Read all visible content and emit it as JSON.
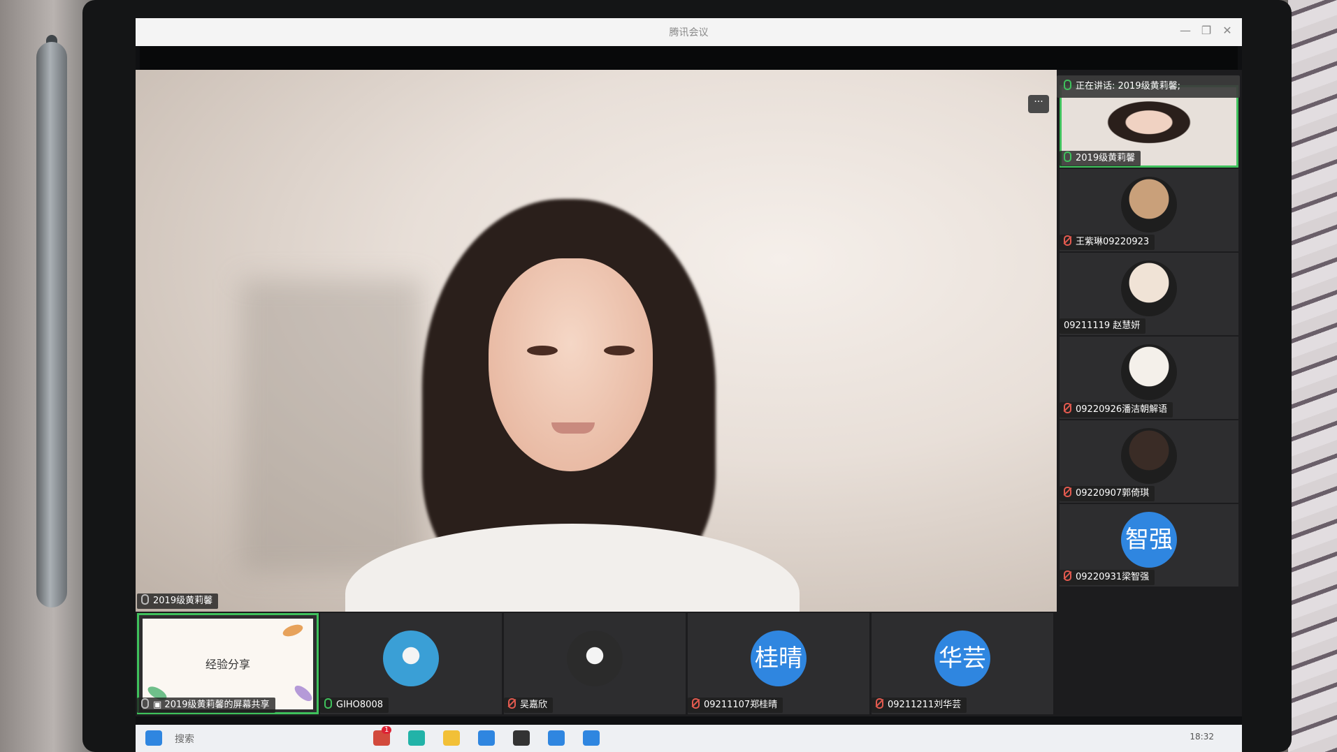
{
  "window": {
    "title": "腾讯会议",
    "minimize": "—",
    "restore": "❐",
    "close": "✕"
  },
  "main_speaker": {
    "name": "2019级黄莉馨"
  },
  "speaking_banner": {
    "label": "正在讲话: 2019级黄莉馨;"
  },
  "more_button": "···",
  "sidebar": {
    "participants": [
      {
        "name": "2019级黄莉馨",
        "mic": "on",
        "kind": "video"
      },
      {
        "name": "王紫琳09220923",
        "mic": "off",
        "kind": "photo",
        "color": "#c9a07a"
      },
      {
        "name": "09211119 赵慧妍",
        "mic": "none",
        "kind": "photo",
        "color": "#f0e3d6"
      },
      {
        "name": "09220926潘洁朝解语",
        "mic": "off",
        "kind": "photo",
        "color": "#f4f0ea"
      },
      {
        "name": "09220907郭倚琪",
        "mic": "off",
        "kind": "photo",
        "color": "#3a2c26"
      },
      {
        "name": "09220931梁智强",
        "mic": "off",
        "kind": "text",
        "avatar_text": "智强"
      }
    ]
  },
  "bottom_row": {
    "share": {
      "name": "2019级黄莉馨的屏幕共享",
      "slide_title": "经验分享"
    },
    "participants": [
      {
        "name": "GIHO8008",
        "mic": "on",
        "kind": "photo",
        "color": "#3a9fd6"
      },
      {
        "name": "吴嘉欣",
        "mic": "off",
        "kind": "photo",
        "color": "#2b2b2b"
      },
      {
        "name": "09211107郑桂晴",
        "mic": "off",
        "kind": "text",
        "avatar_text": "桂晴"
      },
      {
        "name": "09211211刘华芸",
        "mic": "off",
        "kind": "text",
        "avatar_text": "华芸"
      }
    ]
  },
  "taskbar": {
    "search": "搜索",
    "time": "18:32",
    "badge": "1"
  },
  "colors": {
    "accent_green": "#3fc15c",
    "avatar_blue": "#2f86e0",
    "mute_red": "#e25a4f"
  }
}
